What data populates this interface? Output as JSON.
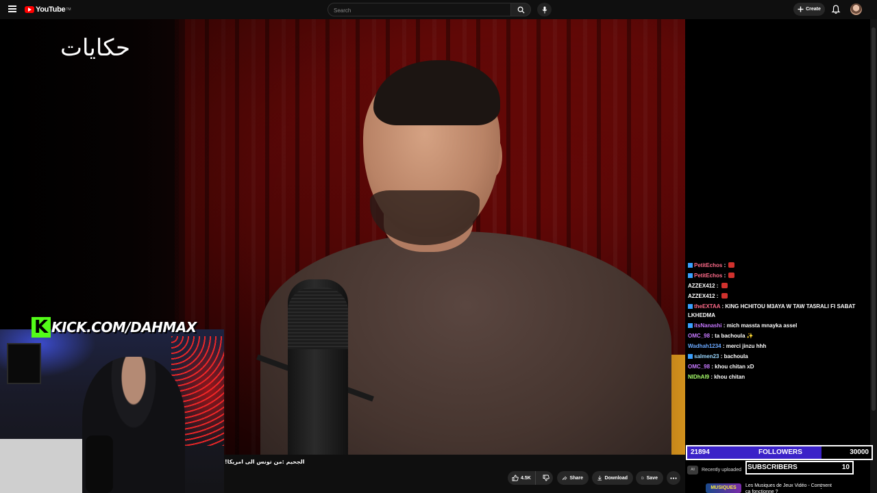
{
  "header": {
    "logo_text": "YouTube",
    "logo_sup": "TM",
    "search_placeholder": "Search",
    "create_label": "Create"
  },
  "video": {
    "channel_watermark": "حكايات",
    "caption": "الجحيم :من تونس الى امريكا!"
  },
  "overlay": {
    "kick_letter": "K",
    "kick_url": "KICK.COM/DAHMAX"
  },
  "actions": {
    "like_count": "4.5K",
    "share_label": "Share",
    "download_label": "Download",
    "save_label": "Save"
  },
  "chat": {
    "messages": [
      {
        "user": "PetitEchos",
        "user_color": "#ff6b8a",
        "text": "",
        "emote": true,
        "badge_color": "#3aa0ff"
      },
      {
        "user": "PetitEchos",
        "user_color": "#ff6b8a",
        "text": "",
        "emote": true,
        "badge_color": "#3aa0ff"
      },
      {
        "user": "AZZEX412",
        "user_color": "#ffffff",
        "text": "",
        "emote": true,
        "badge_color": ""
      },
      {
        "user": "AZZEX412",
        "user_color": "#ffffff",
        "text": "",
        "emote": true,
        "badge_color": ""
      },
      {
        "user": "theEXTAA",
        "user_color": "#ff6b8a",
        "text": "KING HCHITOU M3AYA W TAW TA5RALI FI SABAT LKHEDMA",
        "emote": false,
        "badge_color": "#3aa0ff"
      },
      {
        "user": "itsNanashi",
        "user_color": "#c678ff",
        "text": "mich massta mnayka assel",
        "emote": false,
        "badge_color": "#3aa0ff"
      },
      {
        "user": "OMC_98",
        "user_color": "#c678ff",
        "text": "ta bachoula ✨",
        "emote": false,
        "badge_color": ""
      },
      {
        "user": "Wadhah1234",
        "user_color": "#6aa8ff",
        "text": "merci jinzu hhh",
        "emote": false,
        "badge_color": ""
      },
      {
        "user": "salmen23",
        "user_color": "#9ad7ff",
        "text": "bachoula",
        "emote": false,
        "badge_color": "#3aa0ff"
      },
      {
        "user": "OMC_98",
        "user_color": "#c678ff",
        "text": "khou chitan xD",
        "emote": false,
        "badge_color": ""
      },
      {
        "user": "NIDhAl9",
        "user_color": "#a8ff6b",
        "text": "khou chitan",
        "emote": false,
        "badge_color": ""
      }
    ]
  },
  "goals": {
    "followers_current": "21894",
    "followers_label": "FOLLOWERS",
    "followers_target": "30000",
    "followers_progress": 0.73,
    "subscribers_label": "SUBSCRIBERS",
    "subscribers_value": "10"
  },
  "sidebar": {
    "chip_all": "All",
    "chip_recent": "Recently uploaded",
    "reco_thumb_text": "MUSIQUES",
    "reco_title": "Les Musiques de Jeux Vidéo - Comment ça fonctionne ?"
  },
  "icons": {
    "menu": "menu-icon",
    "search": "search-icon",
    "mic": "mic-icon",
    "bell": "bell-icon",
    "like": "thumbs-up-icon",
    "dislike": "thumbs-down-icon",
    "share": "share-icon",
    "download": "download-icon",
    "save": "save-icon",
    "more": "more-icon"
  },
  "colors": {
    "youtube_red": "#ff0000",
    "kick_green": "#53fc18",
    "goal_fill": "#3b22c8"
  }
}
